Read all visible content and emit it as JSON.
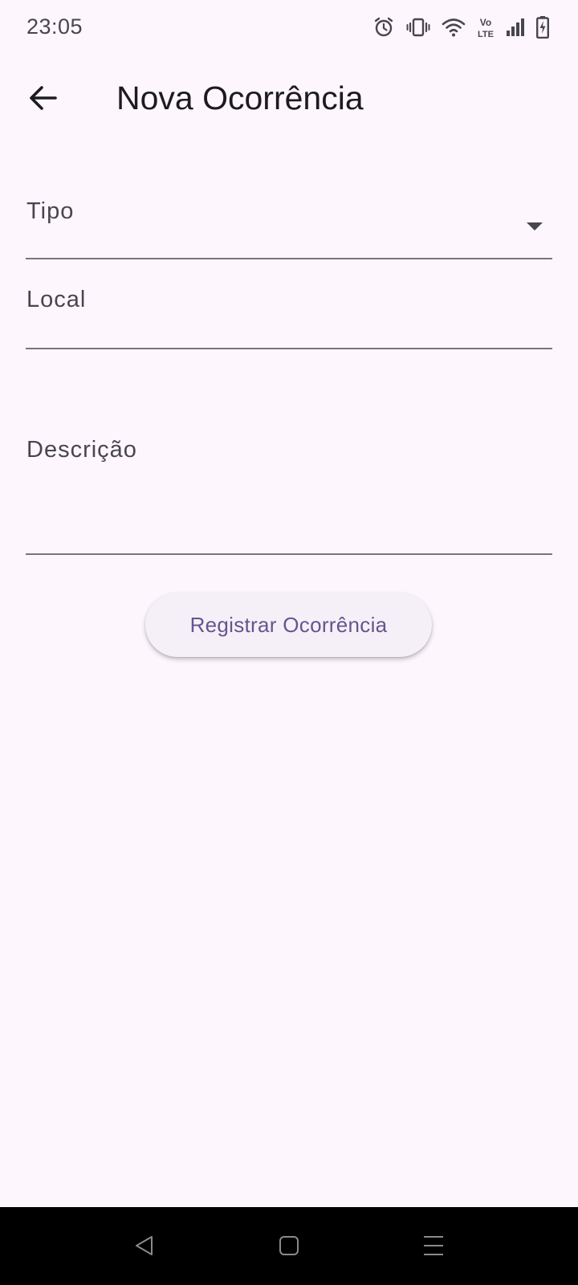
{
  "status_bar": {
    "time": "23:05",
    "icons": [
      "alarm-icon",
      "vibrate-icon",
      "wifi-icon",
      "volte-icon",
      "signal-icon",
      "battery-charging-icon"
    ],
    "volte_text_top": "Vo",
    "volte_text_bottom": "LTE"
  },
  "app_bar": {
    "title": "Nova Ocorrência",
    "back_icon": "arrow-back-icon"
  },
  "form": {
    "tipo": {
      "label": "Tipo",
      "value": "",
      "icon": "arrow-drop-down-icon"
    },
    "local": {
      "label": "Local",
      "value": ""
    },
    "descricao": {
      "label": "Descrição",
      "value": ""
    },
    "submit_label": "Registrar Ocorrência"
  },
  "nav_bar": {
    "buttons": [
      "back-triangle-icon",
      "home-square-icon",
      "recents-menu-icon"
    ]
  },
  "colors": {
    "background": "#fdf7fd",
    "primary_text": "#1d1b20",
    "secondary_text": "#49454f",
    "accent": "#65558f",
    "divider": "#79747e",
    "button_bg": "#f5f0f7",
    "nav_bar": "#000000"
  }
}
